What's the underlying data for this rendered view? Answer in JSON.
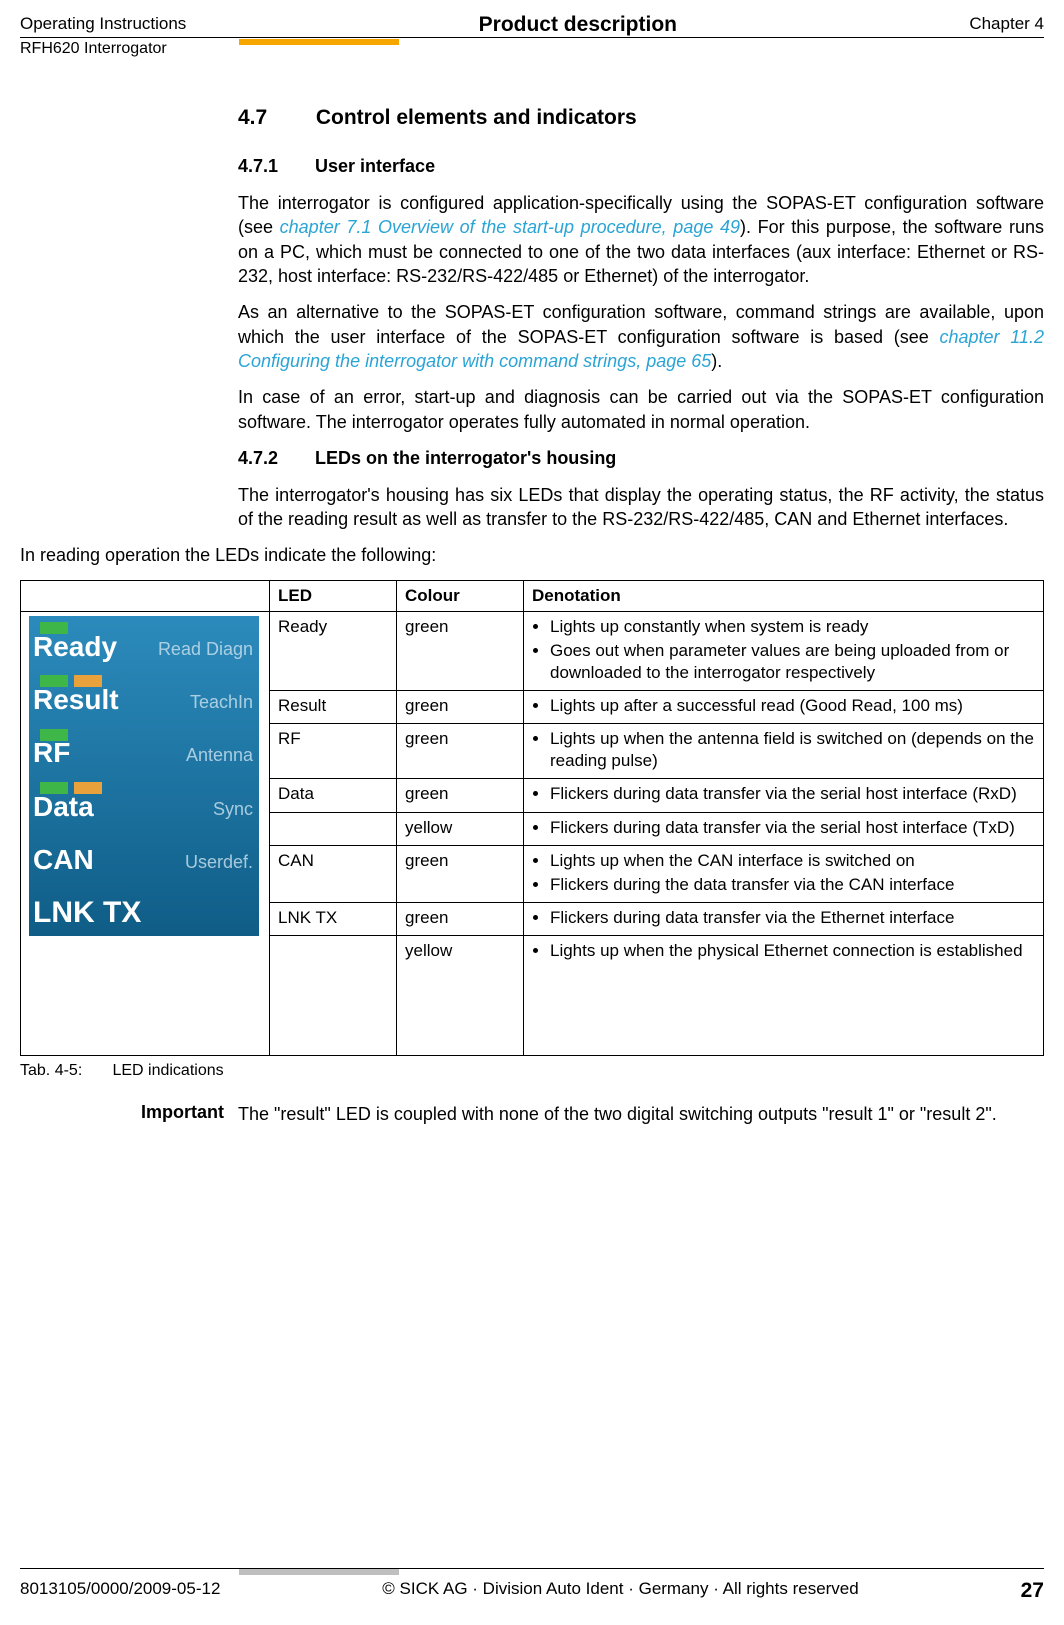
{
  "header": {
    "left_top": "Operating Instructions",
    "left_sub": "RFH620 Interrogator",
    "center": "Product description",
    "right": "Chapter 4"
  },
  "section": {
    "num": "4.7",
    "title": "Control elements and indicators"
  },
  "sub1": {
    "num": "4.7.1",
    "title": "User interface",
    "p1a": "The interrogator is configured application-specifically using the SOPAS-ET configuration software (see ",
    "p1_link": "chapter 7.1 Overview of the start-up procedure, page 49",
    "p1b": "). For this purpose, the software runs on a PC, which must be connected to one of the two data interfaces (aux interface: Ethernet or RS-232, host interface: RS-232/RS-422/485 or Ethernet) of the interrogator.",
    "p2a": "As an alternative to the SOPAS-ET configuration software, command strings are available, upon which the user interface of the SOPAS-ET configuration software is based (see ",
    "p2_link": "chapter 11.2 Configuring the interrogator with command strings, page 65",
    "p2b": ").",
    "p3": "In case of an error, start-up and diagnosis can be carried out via the SOPAS-ET configuration software. The interrogator operates fully automated in normal operation."
  },
  "sub2": {
    "num": "4.7.2",
    "title": "LEDs on the interrogator's housing",
    "p1": "The interrogator's housing has six LEDs that display the operating status, the RF activity, the status of the reading result as well as transfer to the RS-232/RS-422/485, CAN and Ethernet interfaces.",
    "p2": "In reading operation the LEDs indicate the following:"
  },
  "table": {
    "headers": {
      "c1": "LED",
      "c2": "Colour",
      "c3": "Denotation"
    },
    "rows": [
      {
        "led": "Ready",
        "colour": "green",
        "items": [
          "Lights up constantly when system is ready",
          "Goes out when parameter values are being uploaded from or downloaded to the interrogator respectively"
        ]
      },
      {
        "led": "Result",
        "colour": "green",
        "items": [
          "Lights up after a successful read (Good Read, 100 ms)"
        ]
      },
      {
        "led": "RF",
        "colour": "green",
        "items": [
          "Lights up when the antenna field is switched on (depends on the reading pulse)"
        ]
      },
      {
        "led": "Data",
        "colour": "green",
        "items": [
          "Flickers during data transfer via the serial host interface (RxD)"
        ]
      },
      {
        "led": "",
        "colour": "yellow",
        "items": [
          "Flickers during data transfer via the serial host interface (TxD)"
        ]
      },
      {
        "led": "CAN",
        "colour": "green",
        "items": [
          "Lights up when the CAN interface is switched on",
          "Flickers during the data transfer via the CAN interface"
        ]
      },
      {
        "led": "LNK TX",
        "colour": "green",
        "items": [
          "Flickers during data transfer via the Ethernet interface"
        ]
      },
      {
        "led": "",
        "colour": "yellow",
        "items": [
          "Lights up when the physical Ethernet connection is established"
        ],
        "tall": true
      }
    ],
    "caption_prefix": "Tab. 4-5:",
    "caption_text": "LED indications"
  },
  "panel": {
    "rows": [
      {
        "big": "Ready",
        "sub": "Read Diagn",
        "leds": [
          "g"
        ]
      },
      {
        "big": "Result",
        "sub": "TeachIn",
        "leds": [
          "g",
          "o"
        ]
      },
      {
        "big": "RF",
        "sub": "Antenna",
        "leds": [
          "g"
        ]
      },
      {
        "big": "Data",
        "sub": "Sync",
        "leds": [
          "g",
          "o"
        ]
      },
      {
        "big": "CAN",
        "sub": "Userdef.",
        "leds": []
      },
      {
        "big": "LNK TX",
        "sub": "",
        "leds": []
      }
    ]
  },
  "important": {
    "label": "Important",
    "text": "The \"result\" LED is coupled with none of the two digital switching outputs \"result 1\" or \"result 2\"."
  },
  "footer": {
    "left": "8013105/0000/2009-05-12",
    "center": "© SICK AG · Division Auto Ident · Germany · All rights reserved",
    "page": "27"
  }
}
